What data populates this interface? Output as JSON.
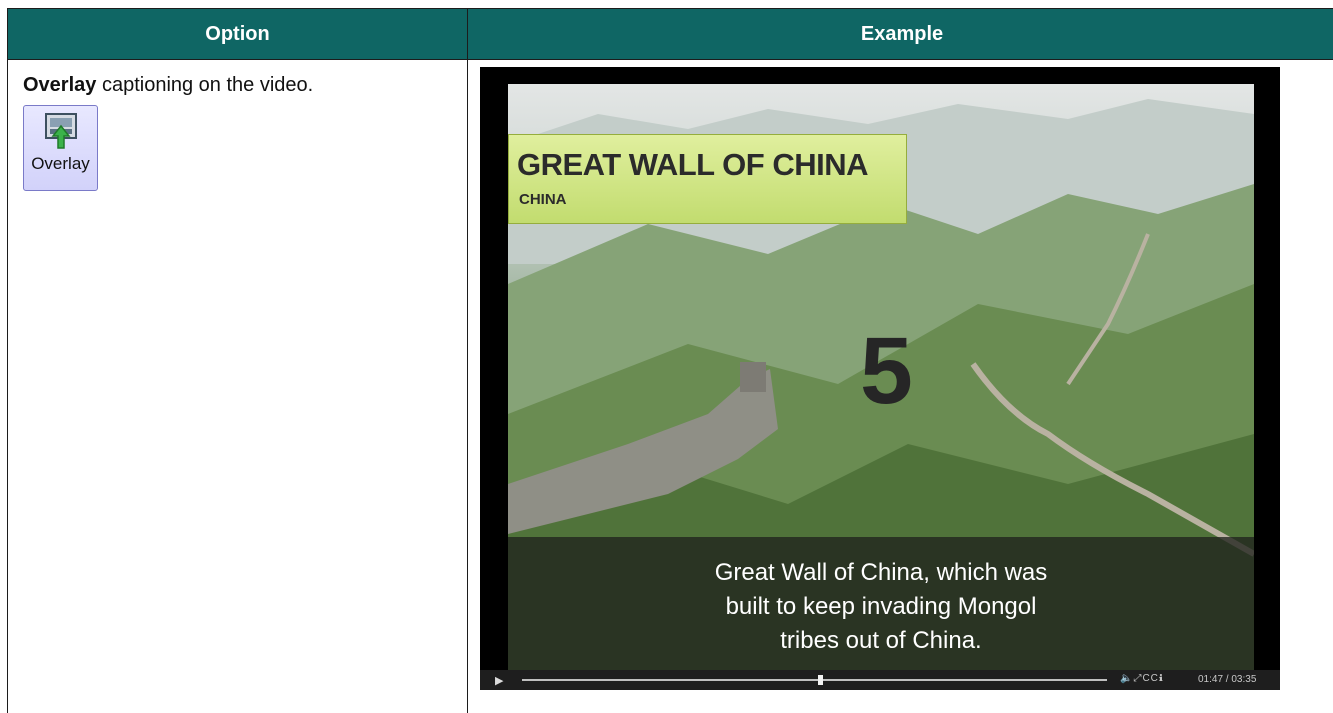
{
  "table": {
    "headers": [
      "Option",
      "Example"
    ]
  },
  "option": {
    "term": "Overlay",
    "description": " captioning on the video.",
    "button_label": "Overlay",
    "button_icon": "overlay-icon"
  },
  "example": {
    "title_main": "GREAT WALL OF CHINA",
    "title_sub": "CHINA",
    "countdown": "5",
    "caption_lines": [
      "Great Wall of China, which was",
      "built to keep invading Mongol",
      "tribes out of China."
    ],
    "player": {
      "timecode": "01:47 / 03:35",
      "progress": 0.51,
      "icons": [
        "play-icon",
        "volume-icon",
        "fullscreen-icon",
        "cc-icon",
        "info-icon"
      ]
    }
  }
}
